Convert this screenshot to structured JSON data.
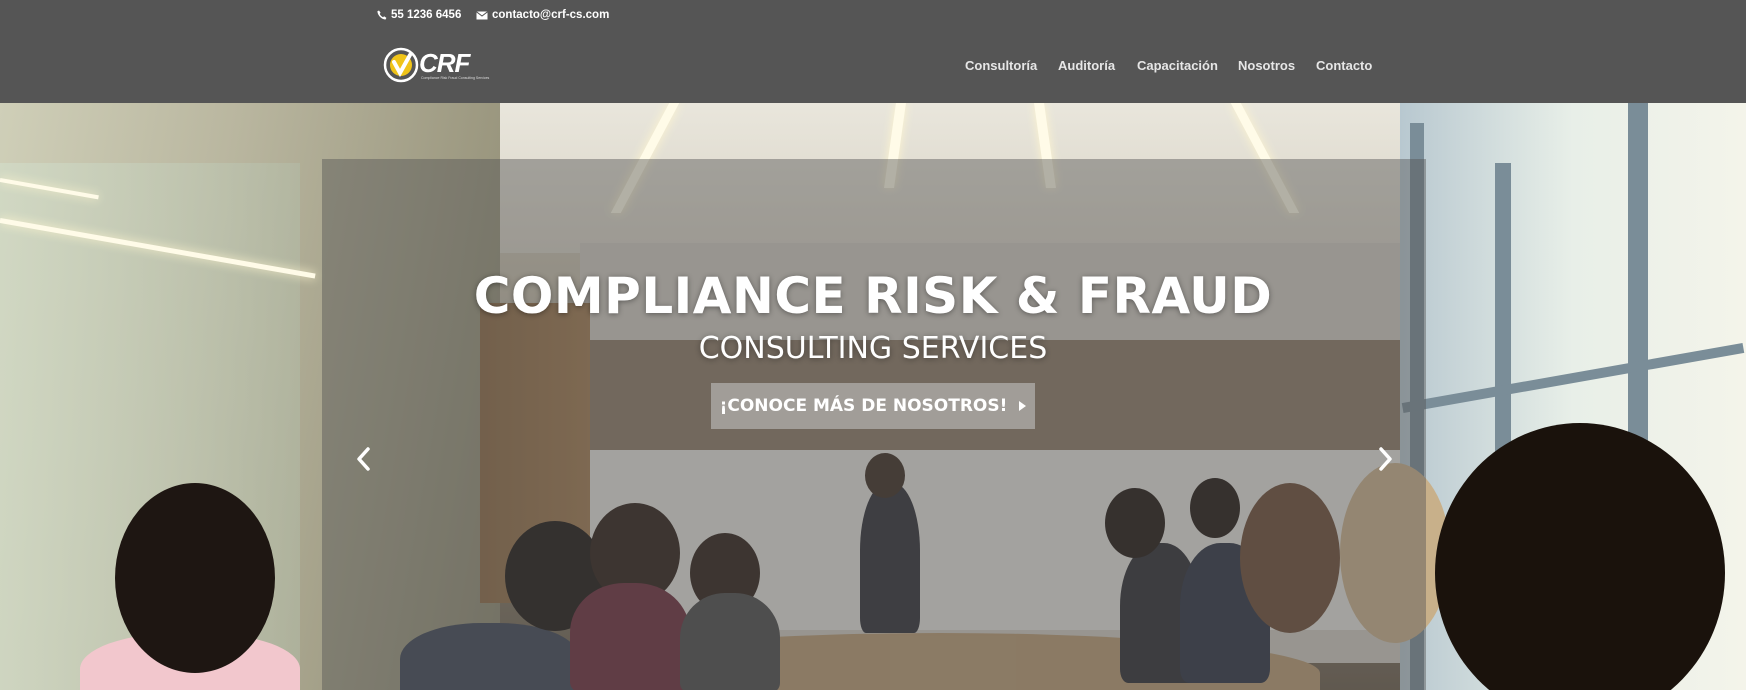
{
  "topbar": {
    "phone": "55 1236 6456",
    "email": "contacto@crf-cs.com",
    "phone_icon": "phone-icon",
    "email_icon": "envelope-icon"
  },
  "header": {
    "logo_text": "CRF",
    "logo_subtext": "Compliance Risk Fraud Consulting Services",
    "nav": [
      {
        "label": "Consultoría"
      },
      {
        "label": "Auditoría"
      },
      {
        "label": "Capacitación"
      },
      {
        "label": "Nosotros"
      },
      {
        "label": "Contacto"
      }
    ]
  },
  "hero": {
    "title": "COMPLIANCE RISK & FRAUD",
    "subtitle": "CONSULTING SERVICES",
    "cta_label": "¡CONOCE MÁS DE NOSOTROS!",
    "prev_icon": "chevron-left-icon",
    "next_icon": "chevron-right-icon"
  },
  "colors": {
    "header_bg": "#555555",
    "logo_accent": "#f0c419",
    "text": "#ffffff"
  }
}
